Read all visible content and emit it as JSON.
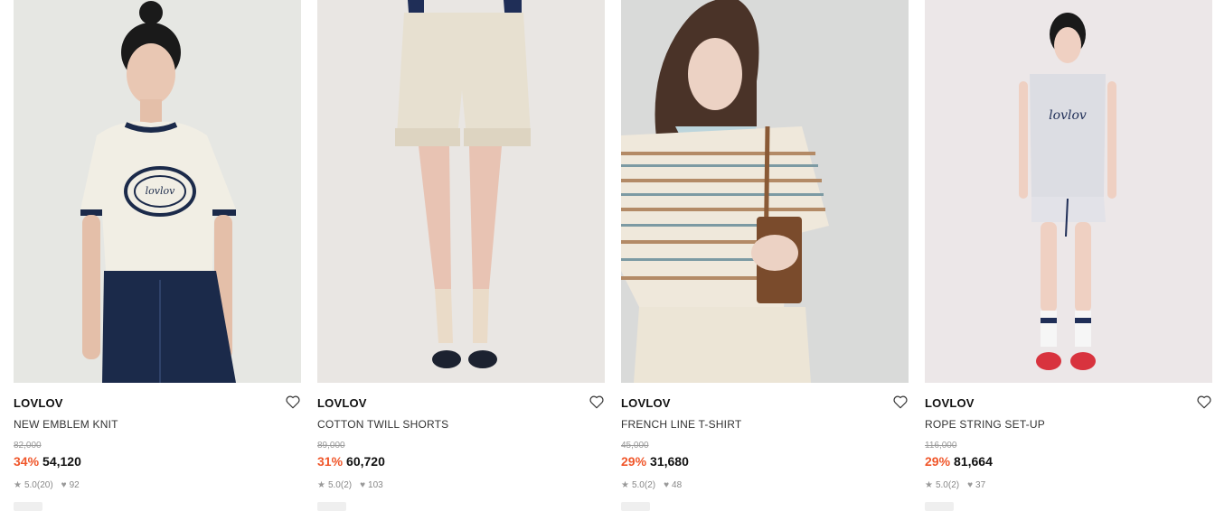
{
  "products": [
    {
      "brand": "LOVLOV",
      "name": "NEW EMBLEM KNIT",
      "original_price": "82,000",
      "discount": "34%",
      "price": "54,120",
      "rating": "5.0",
      "reviews": "(20)",
      "likes": "92",
      "photo_bg": "#e6e7e3",
      "top_color": "#f1eee4",
      "bottom_color": "#1b2a4a"
    },
    {
      "brand": "LOVLOV",
      "name": "COTTON TWILL SHORTS",
      "original_price": "89,000",
      "discount": "31%",
      "price": "60,720",
      "rating": "5.0",
      "reviews": "(2)",
      "likes": "103",
      "photo_bg": "#e9e6e3",
      "top_color": "#1f2e57",
      "bottom_color": "#e7e0d0"
    },
    {
      "brand": "LOVLOV",
      "name": "FRENCH LINE T-SHIRT",
      "original_price": "45,000",
      "discount": "29%",
      "price": "31,680",
      "rating": "5.0",
      "reviews": "(2)",
      "likes": "48",
      "photo_bg": "#d9dad9",
      "top_color": "#efe8db",
      "bottom_color": "#ece5d6"
    },
    {
      "brand": "LOVLOV",
      "name": "ROPE STRING SET-UP",
      "original_price": "116,000",
      "discount": "29%",
      "price": "81,664",
      "rating": "5.0",
      "reviews": "(2)",
      "likes": "37",
      "photo_bg": "#ece7e8",
      "top_color": "#dcdde3",
      "bottom_color": "#e2e2e8"
    }
  ],
  "accent_color": "#f0572b",
  "icons": {
    "wishlist": "heart-outline-icon",
    "rating": "star-icon",
    "likes": "heart-filled-icon"
  }
}
